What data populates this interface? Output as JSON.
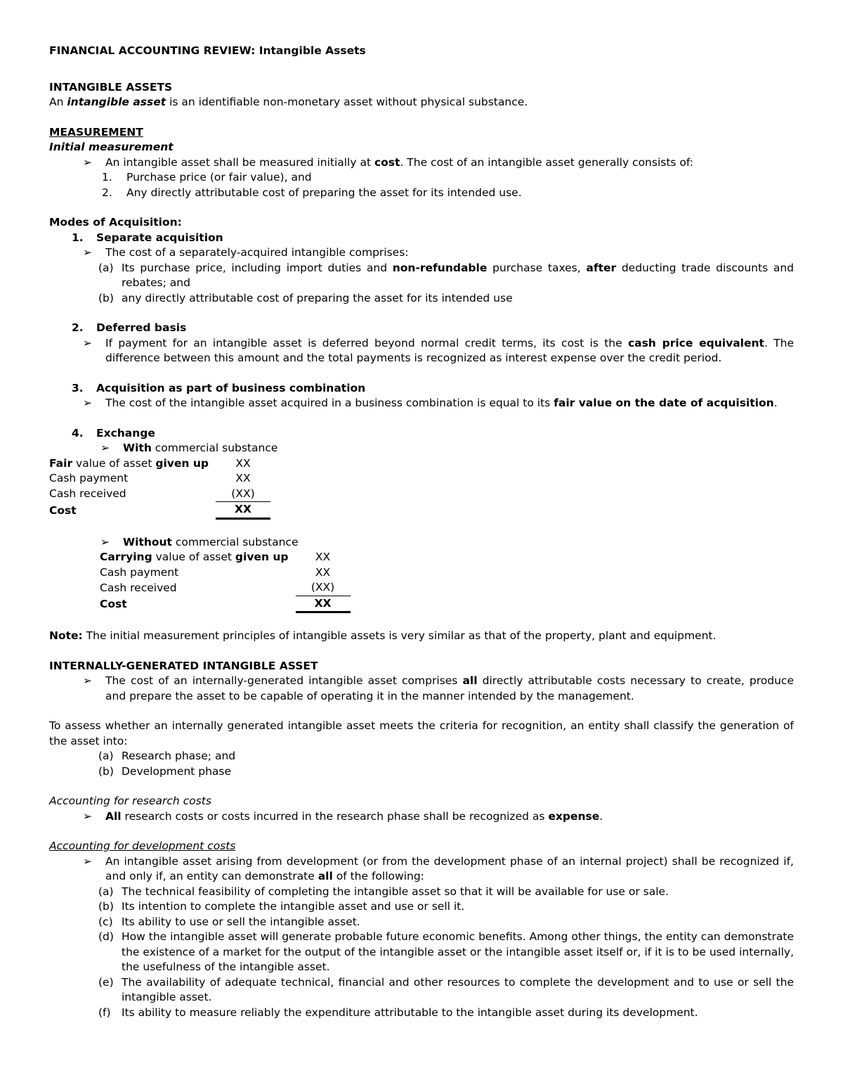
{
  "document": {
    "title": "FINANCIAL ACCOUNTING REVIEW: Intangible Assets",
    "sections": {
      "intangible_assets": {
        "heading": "INTANGIBLE ASSETS",
        "definition_prefix": "An ",
        "definition_term": "intangible asset",
        "definition_rest": " is an identifiable non-monetary asset without physical substance."
      },
      "measurement": {
        "heading": "MEASUREMENT",
        "subheading": "Initial measurement",
        "bullet": {
          "marker": "➢",
          "part1": "An intangible asset shall be measured initially at ",
          "emphasis": "cost",
          "part2": ". The cost of an intangible asset generally consists of:"
        },
        "items": [
          {
            "marker": "1.",
            "text": "Purchase price (or fair value), and"
          },
          {
            "marker": "2.",
            "text": "Any directly attributable cost of preparing the asset for its intended use."
          }
        ]
      },
      "modes_of_acquisition": {
        "heading": "Modes of Acquisition:",
        "mode1": {
          "marker": "1.",
          "title": "Separate acquisition",
          "bullet_marker": "➢",
          "bullet_text": "The cost of a separately-acquired intangible comprises:",
          "items": [
            {
              "marker": "(a)",
              "part1": "Its purchase price, including import duties and ",
              "bold1": "non-refundable",
              "part2": " purchase taxes, ",
              "bold2": "after",
              "part3": " deducting trade discounts and rebates; and"
            },
            {
              "marker": "(b)",
              "part1": "any directly attributable cost of preparing the asset for its intended use",
              "bold1": "",
              "part2": "",
              "bold2": "",
              "part3": ""
            }
          ]
        },
        "mode2": {
          "marker": "2.",
          "title": "Deferred basis",
          "bullet_marker": "➢",
          "part1": "If payment for an intangible asset is deferred beyond normal credit terms, its cost is the ",
          "bold1": "cash price equivalent",
          "part2": ". The difference between this amount and the total payments is recognized as interest expense over the credit period."
        },
        "mode3": {
          "marker": "3.",
          "title": "Acquisition as part of business combination",
          "bullet_marker": "➢",
          "part1": "The cost of the intangible asset acquired in a business combination is equal to its ",
          "bold1": "fair value on the date of acquisition",
          "part2": "."
        },
        "mode4": {
          "marker": "4.",
          "title": "Exchange",
          "with_cs": {
            "bullet_marker": "➢",
            "label_bold": "With",
            "label_rest": " commercial substance",
            "rows": [
              {
                "label_bold": "Fair",
                "label_rest": " value of asset ",
                "label_bold2": "given up",
                "amount": "XX",
                "style": "plain"
              },
              {
                "label_bold": "",
                "label_rest": "Cash payment",
                "label_bold2": "",
                "amount": "XX",
                "style": "plain"
              },
              {
                "label_bold": "",
                "label_rest": "Cash received",
                "label_bold2": "",
                "amount": "(XX)",
                "style": "subtotal"
              },
              {
                "label_bold": "Cost",
                "label_rest": "",
                "label_bold2": "",
                "amount": "XX",
                "style": "total"
              }
            ]
          },
          "without_cs": {
            "bullet_marker": "➢",
            "label_bold": "Without",
            "label_rest": " commercial substance",
            "rows": [
              {
                "label_bold": "Carrying",
                "label_rest": " value of asset ",
                "label_bold2": "given up",
                "amount": "XX",
                "style": "plain"
              },
              {
                "label_bold": "",
                "label_rest": "Cash payment",
                "label_bold2": "",
                "amount": "XX",
                "style": "plain"
              },
              {
                "label_bold": "",
                "label_rest": "Cash received",
                "label_bold2": "",
                "amount": "(XX)",
                "style": "subtotal"
              },
              {
                "label_bold": "Cost",
                "label_rest": "",
                "label_bold2": "",
                "amount": "XX",
                "style": "total"
              }
            ]
          }
        }
      },
      "note": {
        "label": "Note:",
        "text": " The initial measurement principles of intangible assets is very similar as that of the property, plant and equipment."
      },
      "internally_generated": {
        "heading": "INTERNALLY-GENERATED INTANGIBLE ASSET",
        "bullet": {
          "marker": "➢",
          "part1": "The cost of an internally-generated intangible asset comprises ",
          "bold1": "all",
          "part2": " directly attributable costs necessary to create, produce and prepare the asset to be capable of operating it in the manner intended by the management."
        },
        "paragraph": "To assess whether an internally generated intangible asset meets the criteria for recognition, an entity shall classify the generation of the asset into:",
        "items": [
          {
            "marker": "(a)",
            "text": "Research phase; and"
          },
          {
            "marker": "(b)",
            "text": "Development phase"
          }
        ]
      },
      "research_costs": {
        "heading": "Accounting for research costs",
        "bullet": {
          "marker": "➢",
          "bold1": "All",
          "part1": " research costs or costs incurred in the research phase shall be recognized as ",
          "bold2": "expense",
          "part2": "."
        }
      },
      "development_costs": {
        "heading": "Accounting for development costs",
        "bullet": {
          "marker": "➢",
          "part1": "An intangible asset arising from development (or from the development phase of an internal project) shall be recognized if, and only if, an entity can demonstrate ",
          "bold1": "all",
          "part2": " of the following:"
        },
        "items": [
          {
            "marker": "(a)",
            "text": "The technical feasibility of completing the intangible asset so that it will be available for use or sale."
          },
          {
            "marker": "(b)",
            "text": "Its intention to complete the intangible asset and use or sell it."
          },
          {
            "marker": "(c)",
            "text": "Its ability to use or sell the intangible asset."
          },
          {
            "marker": "(d)",
            "text": "How the intangible asset will generate probable future economic benefits. Among other things, the entity can demonstrate the existence of a market for the output of the intangible asset or the intangible asset itself or, if it is to be used internally, the usefulness of the intangible asset."
          },
          {
            "marker": "(e)",
            "text": "The availability of adequate technical, financial and other resources to complete the development and to use or sell the intangible asset."
          },
          {
            "marker": "(f)",
            "text": "Its ability to measure reliably the expenditure attributable to the intangible asset during its development."
          }
        ]
      }
    }
  }
}
